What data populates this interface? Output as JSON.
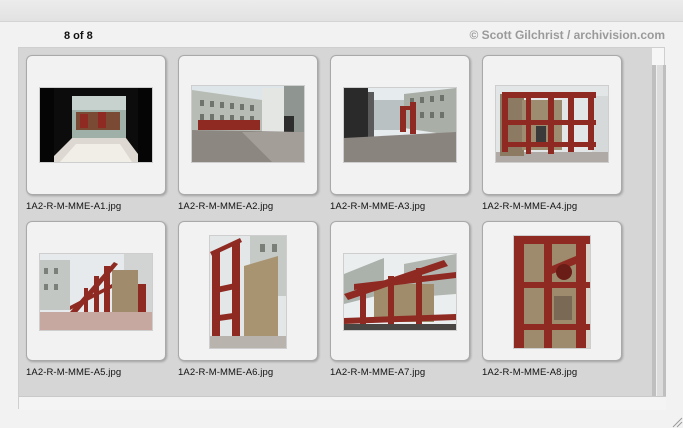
{
  "header": {
    "counter": "8 of 8",
    "copyright": "© Scott Gilchrist / archivision.com"
  },
  "images": [
    {
      "filename": "1A2-R-M-MME-A1.jpg"
    },
    {
      "filename": "1A2-R-M-MME-A2.jpg"
    },
    {
      "filename": "1A2-R-M-MME-A3.jpg"
    },
    {
      "filename": "1A2-R-M-MME-A4.jpg"
    },
    {
      "filename": "1A2-R-M-MME-A5.jpg"
    },
    {
      "filename": "1A2-R-M-MME-A6.jpg"
    },
    {
      "filename": "1A2-R-M-MME-A7.jpg"
    },
    {
      "filename": "1A2-R-M-MME-A8.jpg"
    }
  ],
  "colors": {
    "sculpture_red": "#8e2a22",
    "panel_gray": "#d6d6d6",
    "copyright_gray": "#9a9a9a"
  }
}
